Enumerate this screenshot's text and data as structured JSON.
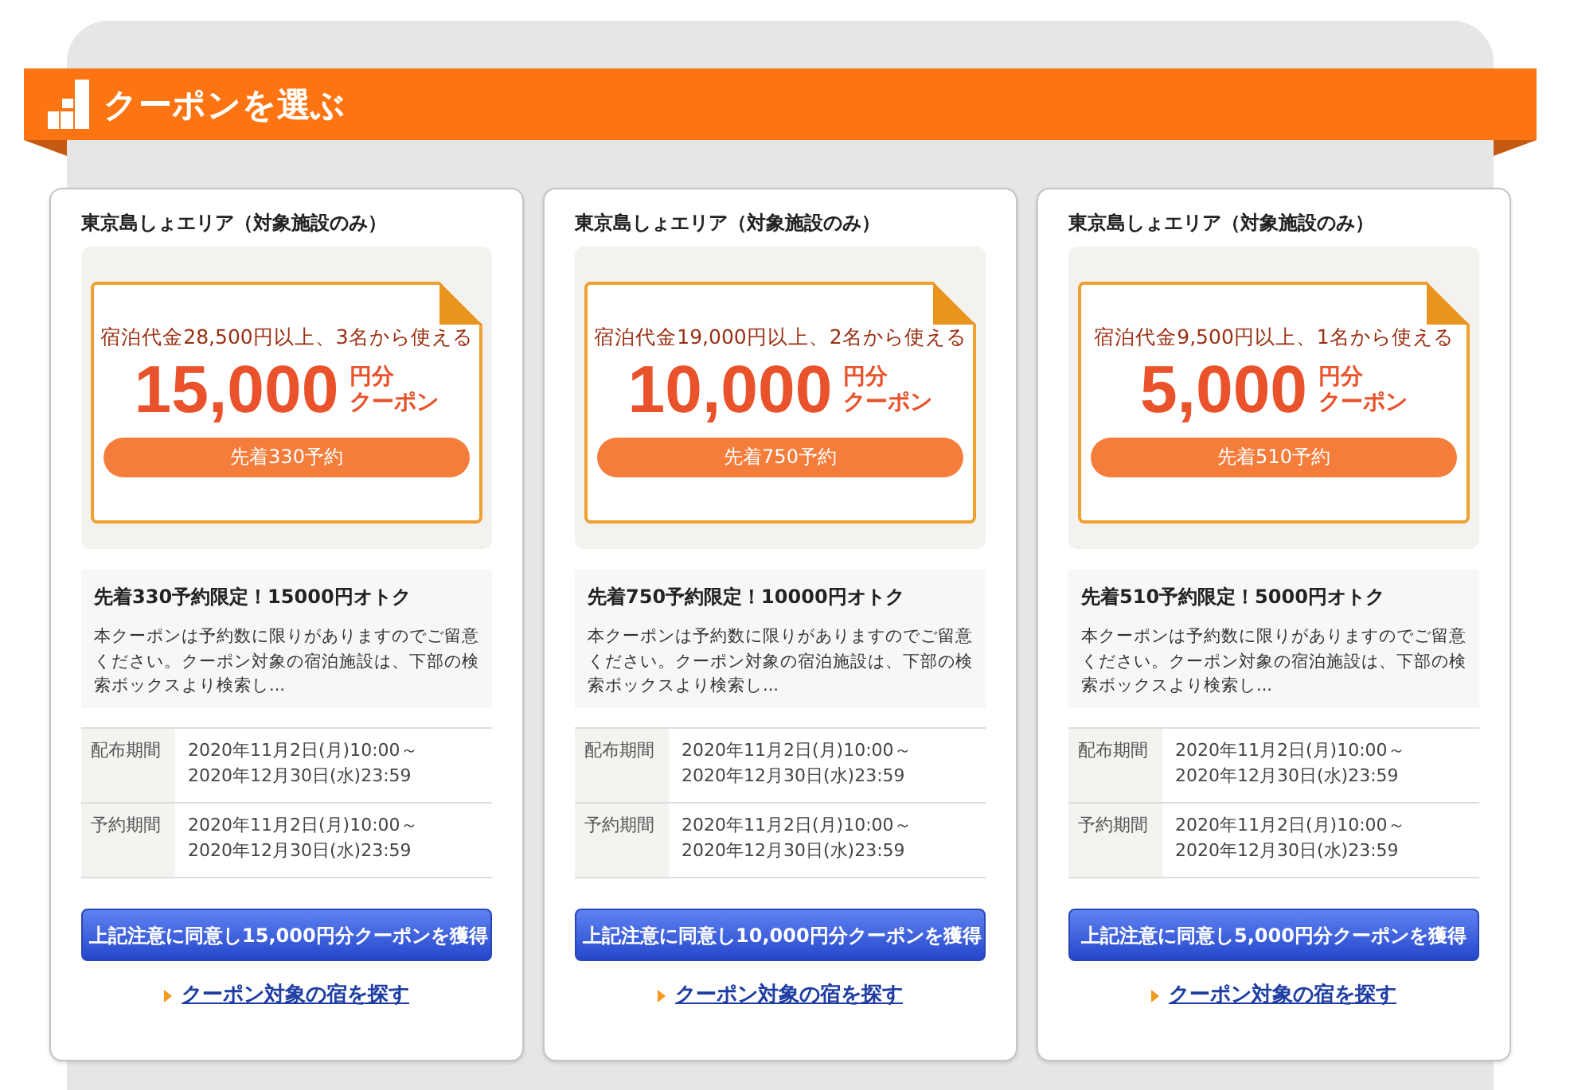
{
  "header": {
    "title": "クーポンを選ぶ"
  },
  "coupons": [
    {
      "area": "東京島しょエリア（対象施設のみ）",
      "condition": "宿泊代金28,500円以上、3名から使える",
      "amount": "15,000",
      "unit_top": "円分",
      "unit_bottom": "クーポン",
      "limit": "先着330予約",
      "headline": "先着330予約限定！15000円オトク",
      "description": "本クーポンは予約数に限りがありますのでご留意ください。クーポン対象の宿泊施設は、下部の検索ボックスより検索し...",
      "periods": [
        {
          "label": "配布期間",
          "start": "2020年11月2日(月)10:00～",
          "end": "2020年12月30日(水)23:59"
        },
        {
          "label": "予約期間",
          "start": "2020年11月2日(月)10:00～",
          "end": "2020年12月30日(水)23:59"
        }
      ],
      "get_button": "上記注意に同意し15,000円分クーポンを獲得",
      "search_link": "クーポン対象の宿を探す"
    },
    {
      "area": "東京島しょエリア（対象施設のみ）",
      "condition": "宿泊代金19,000円以上、2名から使える",
      "amount": "10,000",
      "unit_top": "円分",
      "unit_bottom": "クーポン",
      "limit": "先着750予約",
      "headline": "先着750予約限定！10000円オトク",
      "description": "本クーポンは予約数に限りがありますのでご留意ください。クーポン対象の宿泊施設は、下部の検索ボックスより検索し...",
      "periods": [
        {
          "label": "配布期間",
          "start": "2020年11月2日(月)10:00～",
          "end": "2020年12月30日(水)23:59"
        },
        {
          "label": "予約期間",
          "start": "2020年11月2日(月)10:00～",
          "end": "2020年12月30日(水)23:59"
        }
      ],
      "get_button": "上記注意に同意し10,000円分クーポンを獲得",
      "search_link": "クーポン対象の宿を探す"
    },
    {
      "area": "東京島しょエリア（対象施設のみ）",
      "condition": "宿泊代金9,500円以上、1名から使える",
      "amount": "5,000",
      "unit_top": "円分",
      "unit_bottom": "クーポン",
      "limit": "先着510予約",
      "headline": "先着510予約限定！5000円オトク",
      "description": "本クーポンは予約数に限りがありますのでご留意ください。クーポン対象の宿泊施設は、下部の検索ボックスより検索し...",
      "periods": [
        {
          "label": "配布期間",
          "start": "2020年11月2日(月)10:00～",
          "end": "2020年12月30日(水)23:59"
        },
        {
          "label": "予約期間",
          "start": "2020年11月2日(月)10:00～",
          "end": "2020年12月30日(水)23:59"
        }
      ],
      "get_button": "上記注意に同意し5,000円分クーポンを獲得",
      "search_link": "クーポン対象の宿を探す"
    }
  ]
}
